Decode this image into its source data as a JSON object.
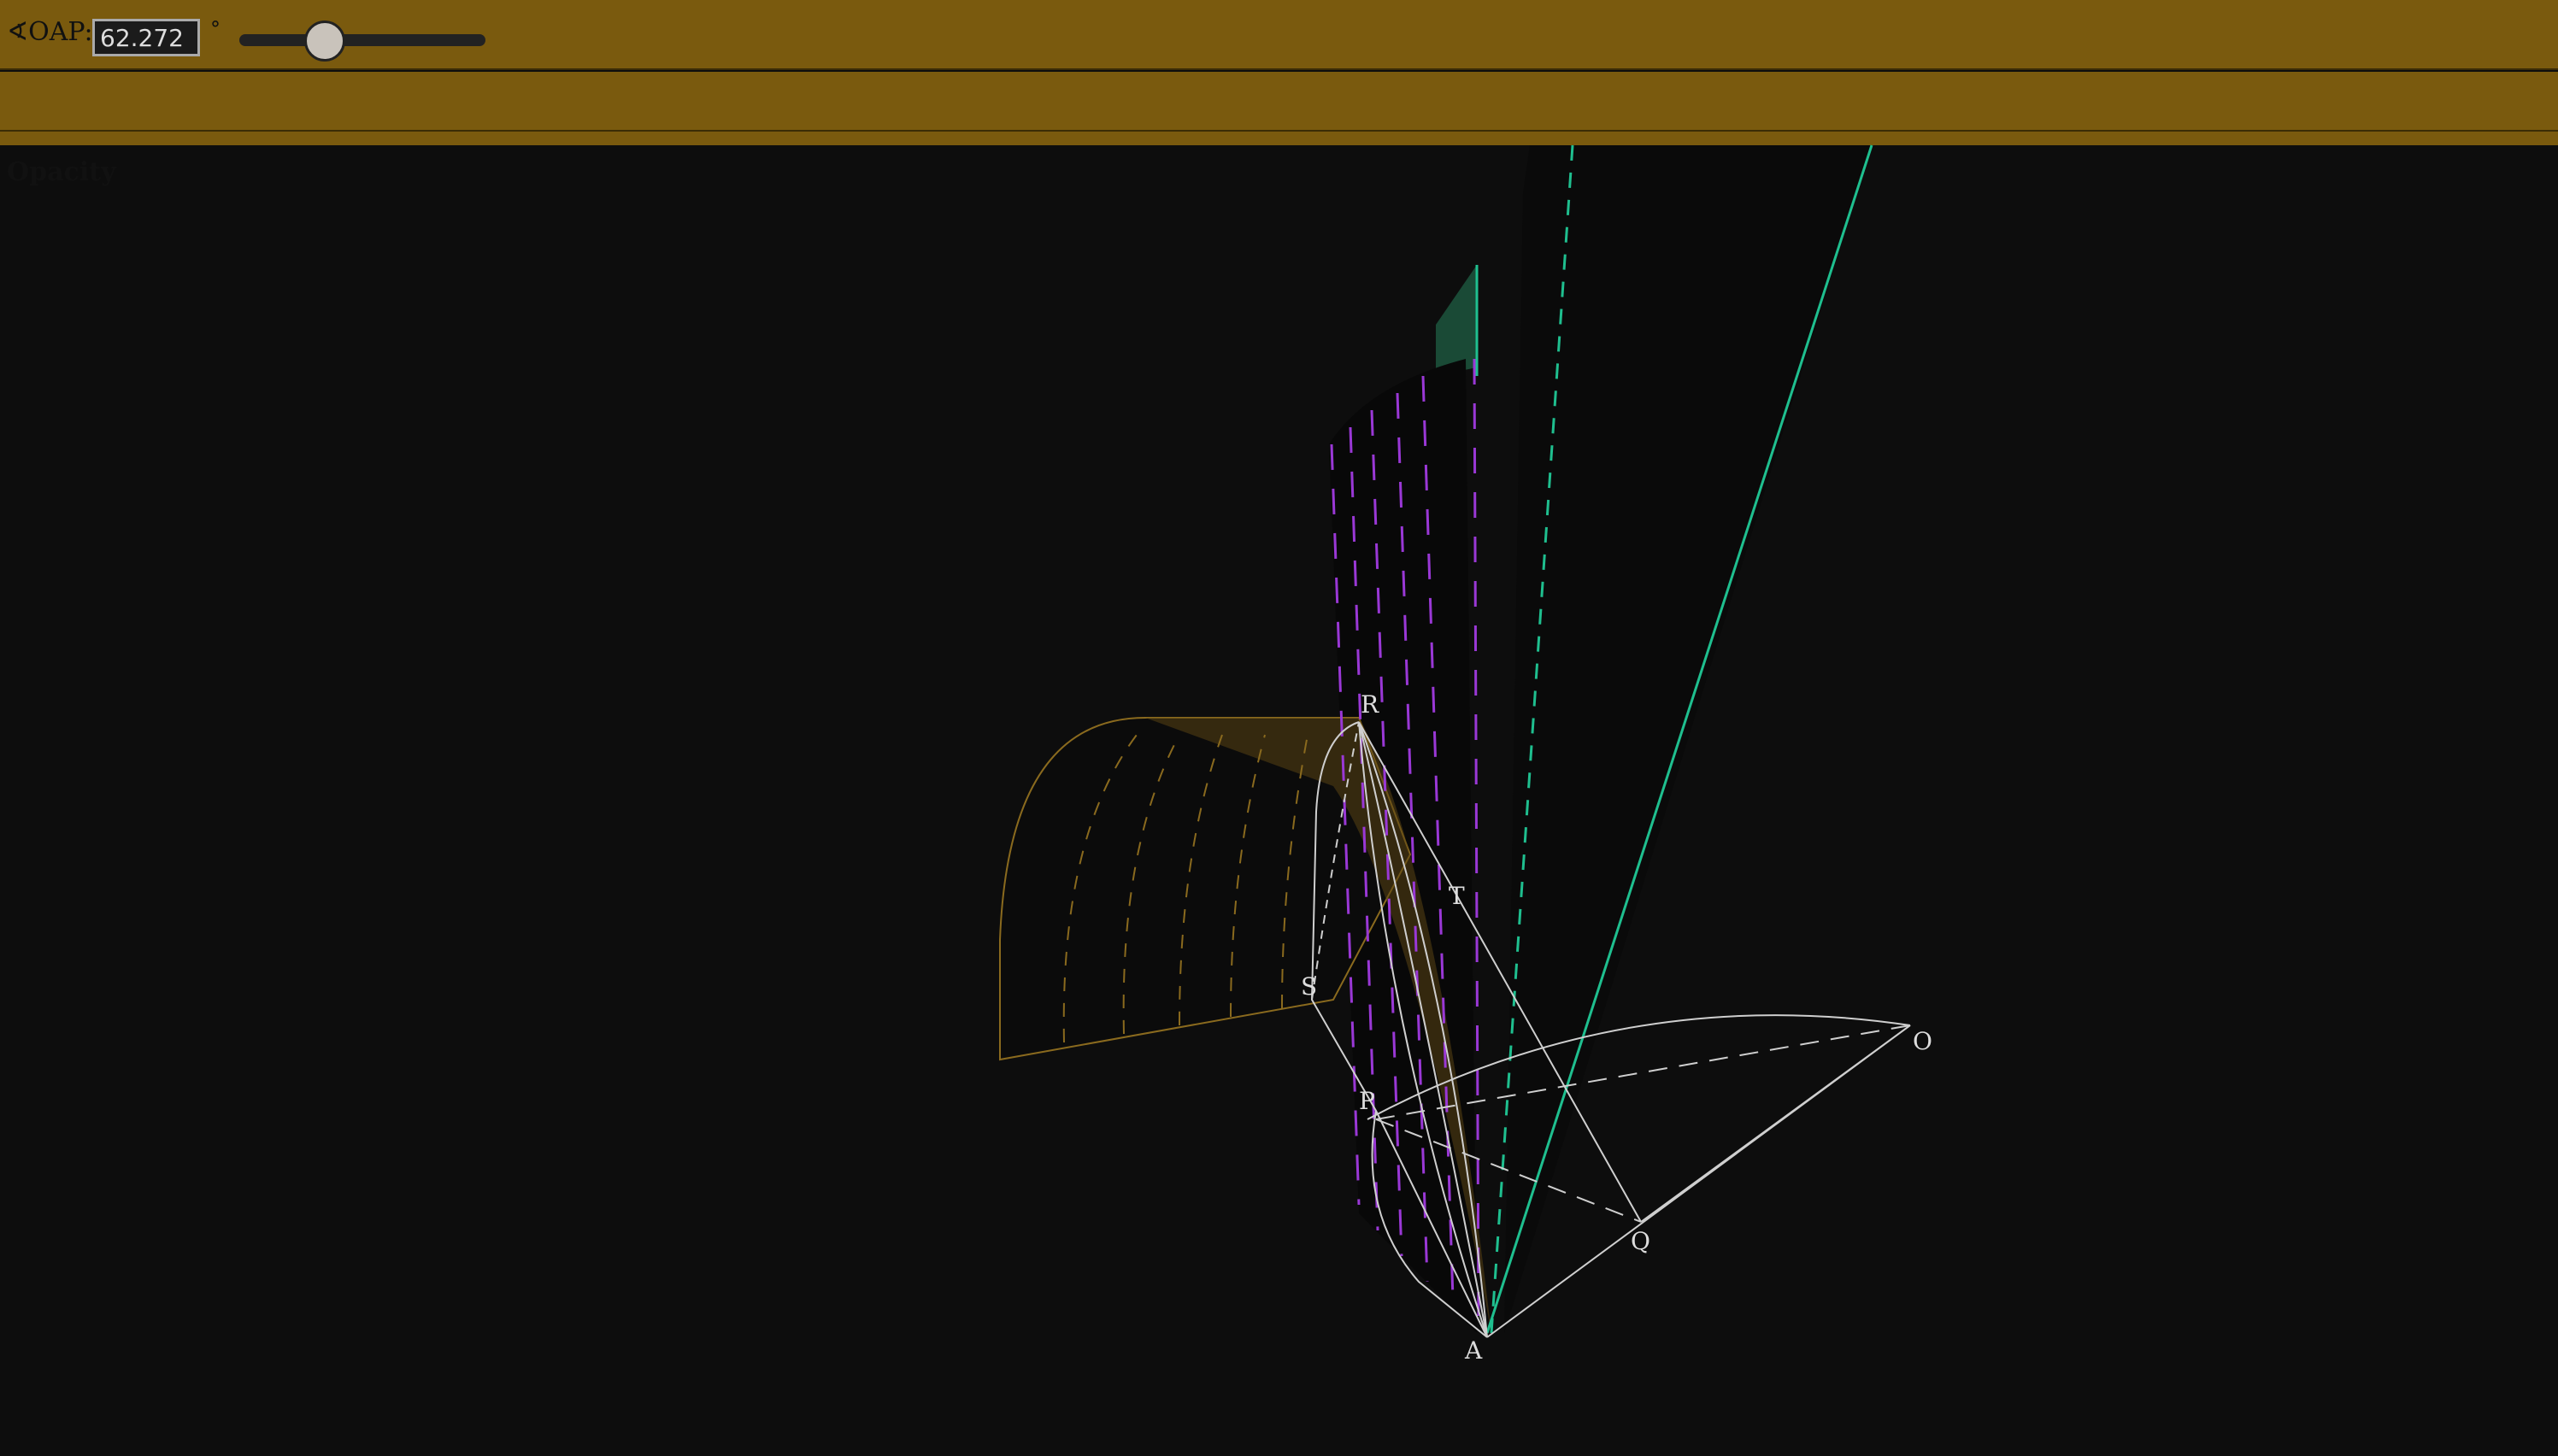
{
  "controls": {
    "angle_label": "∢OAP:",
    "angle_value": "62.272",
    "angle_unit": "°",
    "slider_value": 62.272
  },
  "opacity": {
    "title": "Opacity"
  },
  "points": {
    "R": "R",
    "T": "T",
    "S": "S",
    "P": "P",
    "O": "O",
    "Q": "Q",
    "A": "A"
  },
  "colors": {
    "panel": "#7a5a0e",
    "background": "#0d0d0d",
    "teal_line": "#1fbf8f",
    "purple_dash": "#9a38d6",
    "gold_surface": "#8a6a1e",
    "white_line": "#cfcfcf"
  }
}
